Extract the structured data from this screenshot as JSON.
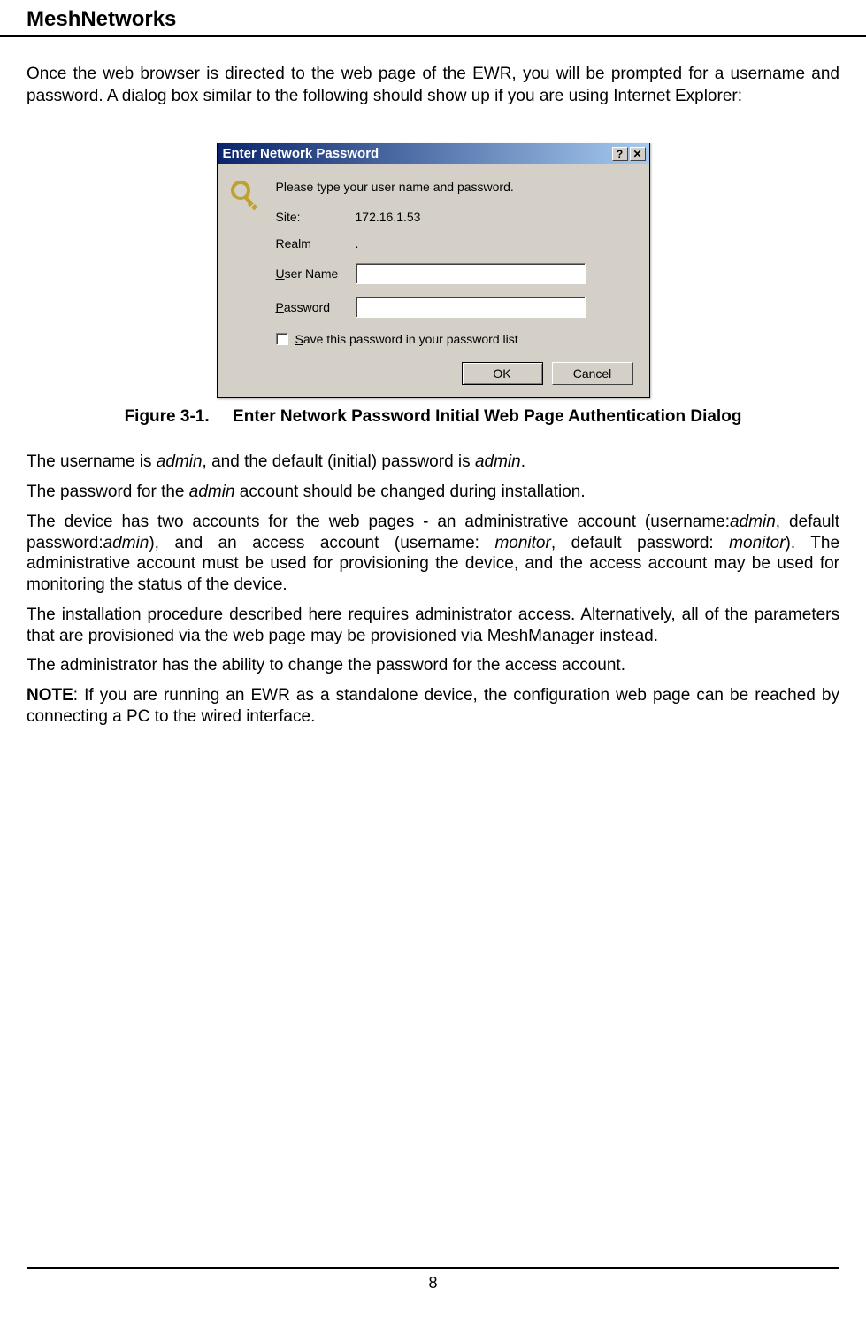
{
  "header": {
    "title": "MeshNetworks"
  },
  "intro": "Once the web browser is directed to the web page of the EWR, you will be prompted for a username and password. A dialog box similar to the following should show up if you are using Internet Explorer:",
  "dialog": {
    "title": "Enter Network Password",
    "help_btn": "?",
    "close_btn": "✕",
    "instruction": "Please type your user name and password.",
    "site_label": "Site:",
    "site_value": "172.16.1.53",
    "realm_label": "Realm",
    "realm_value": ".",
    "username_label_pre": "U",
    "username_label_post": "ser Name",
    "password_label_pre": "P",
    "password_label_post": "assword",
    "save_checkbox_pre": "S",
    "save_checkbox_post": "ave this password in your password list",
    "ok_button": "OK",
    "cancel_button": "Cancel"
  },
  "figure": {
    "number": "Figure 3-1.",
    "caption": "Enter Network Password Initial Web Page Authentication Dialog"
  },
  "paragraphs": {
    "p1_pre": "The username is ",
    "p1_admin1": "admin",
    "p1_mid": ", and the default (initial) password is ",
    "p1_admin2": "admin",
    "p1_end": ".",
    "p2_pre": "The password for the ",
    "p2_admin": "admin",
    "p2_post": " account should be changed during installation.",
    "p3_pre": "The device has two accounts for the web pages - an administrative account (username:",
    "p3_admin1": "admin",
    "p3_mid1": ", default password:",
    "p3_admin2": "admin",
    "p3_mid2": "), and an access account (username: ",
    "p3_monitor1": "monitor",
    "p3_mid3": ", default password: ",
    "p3_monitor2": "monitor",
    "p3_end": "). The administrative account must be used for provisioning the device, and the access account may be used for monitoring the status of the device.",
    "p4": "The installation procedure described here requires administrator access. Alternatively, all of the parameters that are provisioned via the web page may be provisioned via MeshManager instead.",
    "p5": "The administrator has the ability to change the password for the access account.",
    "p6_note": "NOTE",
    "p6_body": ": If you are running an EWR as a standalone device, the configuration web page can be reached by connecting a PC to the wired interface."
  },
  "footer": {
    "page_number": "8"
  }
}
